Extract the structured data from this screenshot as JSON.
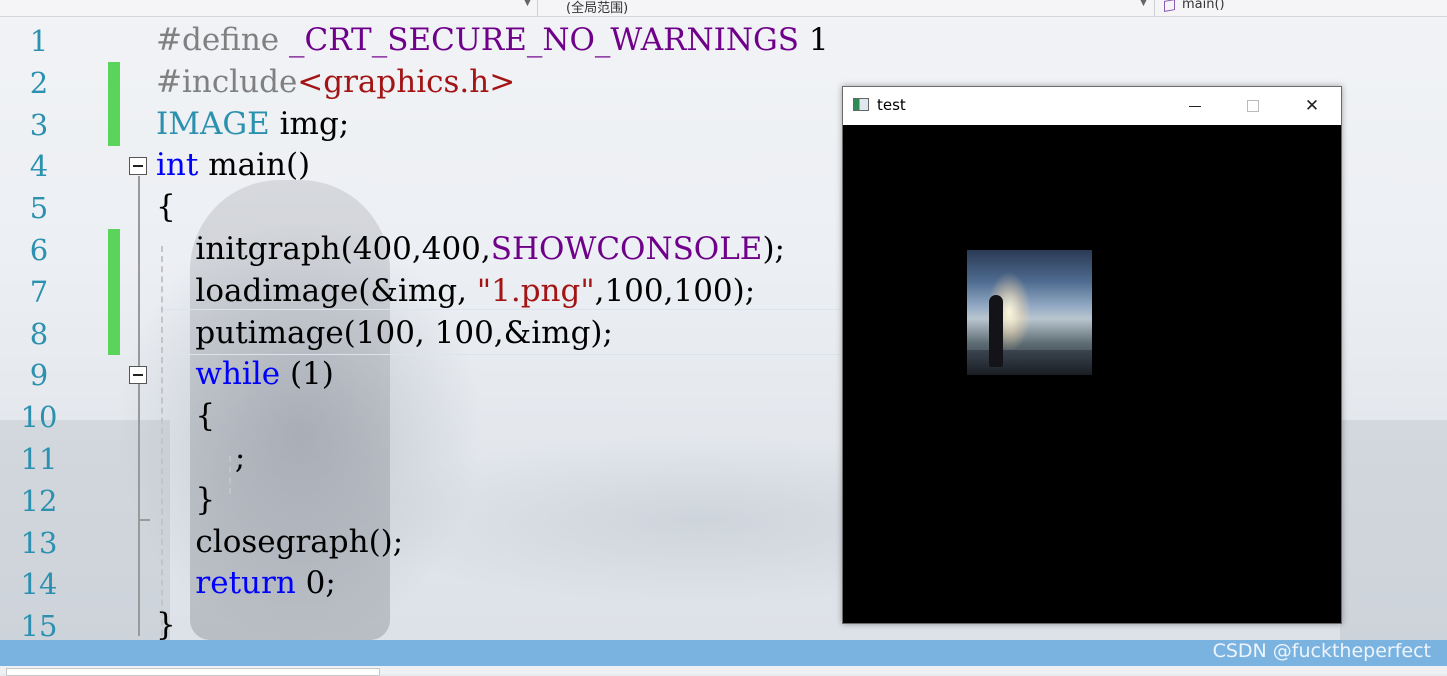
{
  "navbar": {
    "scope_label": "(全局范围)",
    "function_label": "main()"
  },
  "editor": {
    "lines": [
      {
        "num": "1",
        "tokens": [
          [
            "pp",
            "#define "
          ],
          [
            "mac",
            "_CRT_SECURE_NO_WARNINGS"
          ],
          [
            "",
            " 1"
          ]
        ]
      },
      {
        "num": "2",
        "tokens": [
          [
            "pp",
            "#include"
          ],
          [
            "str",
            "<graphics.h>"
          ]
        ]
      },
      {
        "num": "3",
        "tokens": [
          [
            "typ",
            "IMAGE"
          ],
          [
            "",
            " img;"
          ]
        ]
      },
      {
        "num": "4",
        "tokens": [
          [
            "kw",
            "int"
          ],
          [
            "",
            " main()"
          ]
        ]
      },
      {
        "num": "5",
        "tokens": [
          [
            "",
            "{"
          ]
        ]
      },
      {
        "num": "6",
        "tokens": [
          [
            "",
            "    initgraph(400,400,"
          ],
          [
            "mac",
            "SHOWCONSOLE"
          ],
          [
            "",
            ");"
          ]
        ]
      },
      {
        "num": "7",
        "tokens": [
          [
            "",
            "    loadimage(&img, "
          ],
          [
            "str",
            "\"1.png\""
          ],
          [
            "",
            ",100,100);"
          ]
        ]
      },
      {
        "num": "8",
        "tokens": [
          [
            "",
            "    putimage(100, 100,&img);"
          ]
        ]
      },
      {
        "num": "9",
        "tokens": [
          [
            "",
            "    "
          ],
          [
            "kw",
            "while"
          ],
          [
            "",
            " (1)"
          ]
        ]
      },
      {
        "num": "10",
        "tokens": [
          [
            "",
            "    {"
          ]
        ]
      },
      {
        "num": "11",
        "tokens": [
          [
            "",
            "        ;"
          ]
        ]
      },
      {
        "num": "12",
        "tokens": [
          [
            "",
            "    }"
          ]
        ]
      },
      {
        "num": "13",
        "tokens": [
          [
            "",
            "    closegraph();"
          ]
        ]
      },
      {
        "num": "14",
        "tokens": [
          [
            "",
            "    "
          ],
          [
            "kw",
            "return"
          ],
          [
            "",
            " 0;"
          ]
        ]
      },
      {
        "num": "15",
        "tokens": [
          [
            "",
            "}"
          ]
        ]
      }
    ]
  },
  "window": {
    "title": "test",
    "close_glyph": "✕"
  },
  "status": {
    "watermark": "CSDN @fucktheperfect"
  },
  "colors": {
    "keyword": "#0000ff",
    "macro": "#6f008a",
    "string": "#a31515",
    "type": "#2b91af",
    "preprocessor": "#808080",
    "line_number": "#2b91af",
    "change_marker": "#5ad45a",
    "status_bar": "#7ab3e0"
  }
}
